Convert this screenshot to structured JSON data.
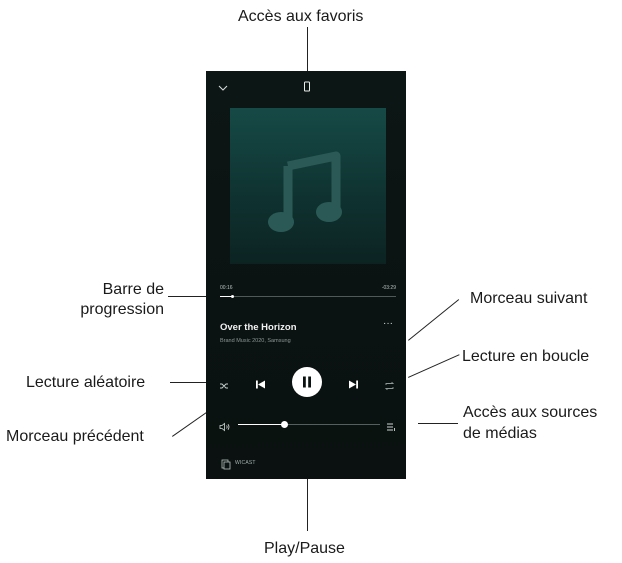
{
  "callouts": {
    "favorites": "Accès aux favoris",
    "progress_line1": "Barre de",
    "progress_line2": "progression",
    "next": "Morceau suivant",
    "repeat": "Lecture en boucle",
    "shuffle": "Lecture aléatoire",
    "previous": "Morceau précédent",
    "sources_line1": "Accès aux sources",
    "sources_line2": "de médias",
    "playpause": "Play/Pause"
  },
  "player": {
    "elapsed": "00:16",
    "remaining": "-03:29",
    "progress_fraction": 0.07,
    "volume_fraction": 0.33,
    "track_title": "Over the Horizon",
    "track_subtitle": "Brand Music 2020, Samsung",
    "more_label": "···",
    "wicast_label": "WICAST",
    "icons": {
      "collapse": "chevron-down-icon",
      "device": "phone-icon",
      "album_art": "music-note-icon",
      "shuffle": "shuffle-icon",
      "previous": "skip-previous-icon",
      "playpause": "pause-icon",
      "next": "skip-next-icon",
      "repeat": "repeat-icon",
      "volume": "volume-icon",
      "sources": "playlist-icon",
      "wicast": "wicast-icon"
    },
    "colors": {
      "background": "#0b1312",
      "album_top": "#164a46",
      "accent_white": "#ffffff"
    }
  }
}
